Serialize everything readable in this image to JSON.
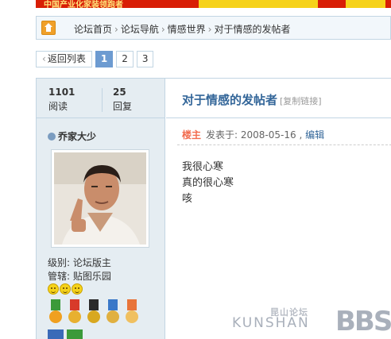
{
  "banner": {
    "text": "中国产业化家装领跑者",
    "color": "#d81e06"
  },
  "breadcrumb": {
    "items": [
      "论坛首页",
      "论坛导航",
      "情感世界",
      "对于情感的发帖者"
    ],
    "separator": "›"
  },
  "pager": {
    "back_label": "返回列表",
    "pages": [
      "1",
      "2",
      "3"
    ],
    "current": "1"
  },
  "stats": {
    "views": {
      "value": "1101",
      "label": "阅读"
    },
    "replies": {
      "value": "25",
      "label": "回复"
    }
  },
  "author": {
    "name": "乔家大少",
    "level": "级别: 论坛版主",
    "manages": "管辖: 贴图乐园"
  },
  "thread": {
    "title": "对于情感的发帖者",
    "copy_link": "[复制链接]"
  },
  "post": {
    "owner_badge": "楼主",
    "posted_prefix": "发表于: ",
    "date": "2008-05-16",
    "separator": " , ",
    "edit_label": "编辑",
    "lines": [
      "我很心寒",
      "真的很心寒",
      "咳"
    ]
  },
  "watermark": {
    "top": "昆山论坛",
    "main": "KUNSHAN",
    "big": "BBS"
  },
  "colors": {
    "accent": "#336699",
    "sidebar_bg": "#e5edf2",
    "border": "#c2d5e3",
    "owner": "#f26c4f"
  }
}
